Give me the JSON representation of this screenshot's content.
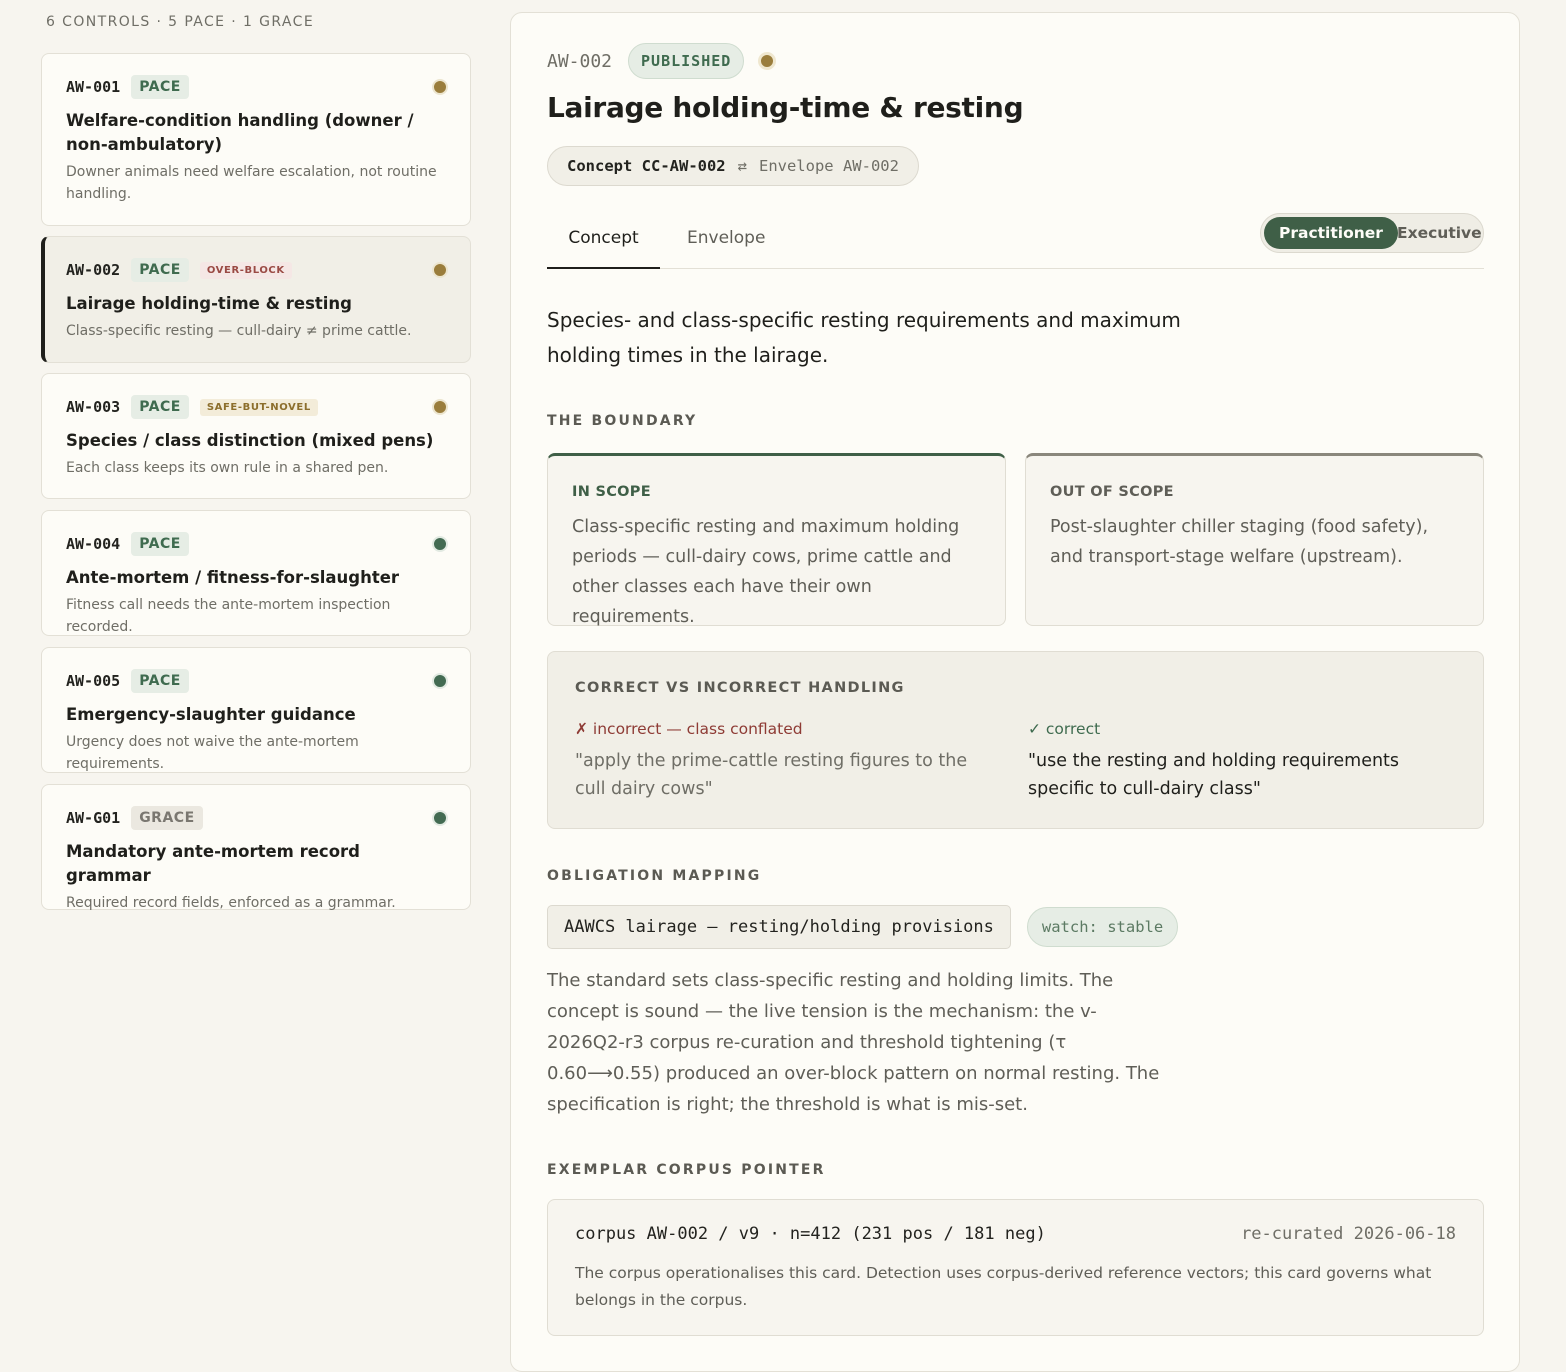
{
  "sidebar": {
    "header": "6 CONTROLS · 5 PACE · 1 GRACE",
    "cards": [
      {
        "id": "AW-001",
        "tier": "PACE",
        "flag": "",
        "title": "Welfare-condition handling (downer / non-ambulatory)",
        "desc": "Downer animals need welfare escalation, not routine handling."
      },
      {
        "id": "AW-002",
        "tier": "PACE",
        "flag": "OVER-BLOCK",
        "title": "Lairage holding-time & resting",
        "desc": "Class-specific resting — cull-dairy ≠ prime cattle."
      },
      {
        "id": "AW-003",
        "tier": "PACE",
        "flag": "SAFE-BUT-NOVEL",
        "title": "Species / class distinction (mixed pens)",
        "desc": "Each class keeps its own rule in a shared pen."
      },
      {
        "id": "AW-004",
        "tier": "PACE",
        "flag": "",
        "title": "Ante-mortem / fitness-for-slaughter",
        "desc": "Fitness call needs the ante-mortem inspection recorded."
      },
      {
        "id": "AW-005",
        "tier": "PACE",
        "flag": "",
        "title": "Emergency-slaughter guidance",
        "desc": "Urgency does not waive the ante-mortem requirements."
      },
      {
        "id": "AW-G01",
        "tier": "GRACE",
        "flag": "",
        "title": "Mandatory ante-mortem record grammar",
        "desc": "Required record fields, enforced as a grammar."
      }
    ]
  },
  "detail": {
    "id": "AW-002",
    "status": "PUBLISHED",
    "title": "Lairage holding-time & resting",
    "concept_label": "Concept CC-AW-002",
    "concept_arrow": "⇄",
    "envelope_label": "Envelope AW-002",
    "tabs": {
      "concept": "Concept",
      "envelope": "Envelope"
    },
    "audience": {
      "practitioner": "Practitioner",
      "executive": "Executive"
    },
    "summary": "Species- and class-specific resting requirements and maximum holding times in the lairage.",
    "boundary": {
      "label": "THE BOUNDARY",
      "in_title": "IN SCOPE",
      "in_body": "Class-specific resting and maximum holding periods — cull-dairy cows, prime cattle and other classes each have their own requirements.",
      "out_title": "OUT OF SCOPE",
      "out_body": "Post-slaughter chiller staging (food safety), and transport-stage welfare (upstream)."
    },
    "handling": {
      "label": "CORRECT VS INCORRECT HANDLING",
      "incorrect_tag": "✗ incorrect — class conflated",
      "incorrect_quote": "\"apply the prime-cattle resting figures to the cull dairy cows\"",
      "correct_tag": "✓ correct",
      "correct_quote": "\"use the resting and holding requirements specific to cull-dairy class\""
    },
    "obligation": {
      "label": "OBLIGATION MAPPING",
      "mapping": "AAWCS lairage — resting/holding provisions",
      "watch": "watch: stable",
      "text": "The standard sets class-specific resting and holding limits. The concept is sound — the live tension is the mechanism: the v-2026Q2-r3 corpus re-curation and threshold tightening (τ 0.60⟶0.55) produced an over-block pattern on normal resting. The specification is right; the threshold is what is mis-set."
    },
    "corpus": {
      "label": "EXEMPLAR CORPUS POINTER",
      "id": "corpus AW-002 / v9 · n=412 (231 pos / 181 neg)",
      "date": "re-curated 2026-06-18",
      "text": "The corpus operationalises this card. Detection uses corpus-derived reference vectors; this card governs what belongs in the corpus."
    }
  },
  "colors": {
    "accent_green": "#3f5f47",
    "status_amber": "#9a7d3c",
    "status_green": "#436b52",
    "flag_red": "#9a4a44"
  }
}
